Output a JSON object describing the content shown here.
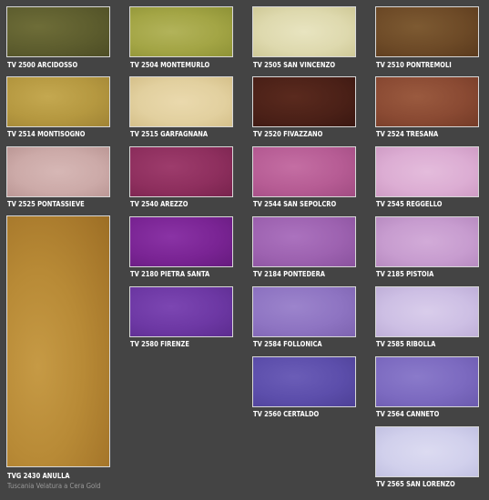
{
  "swatches": [
    {
      "code": "TV 2500 ARCIDOSSO",
      "color": "#5d5d2e"
    },
    {
      "code": "TV 2504 MONTEMURLO",
      "color": "#a3a545"
    },
    {
      "code": "TV 2505 SAN VINCENZO",
      "color": "#ded9ae"
    },
    {
      "code": "TV 2510 PONTREMOLI",
      "color": "#6d4a27"
    },
    {
      "code": "TV 2514 MONTISOGNO",
      "color": "#b59840"
    },
    {
      "code": "TV 2515 GARFAGNANA",
      "color": "#e2d09f"
    },
    {
      "code": "TV 2520 FIVAZZANO",
      "color": "#4a2017"
    },
    {
      "code": "TV 2524 TRESANA",
      "color": "#8a4a33"
    },
    {
      "code": "TV 2525 PONTASSIEVE",
      "color": "#ccaaa8"
    },
    {
      "code": "TV 2540 AREZZO",
      "color": "#8e2f5e"
    },
    {
      "code": "TV 2544 SAN SEPOLCRO",
      "color": "#b65c94"
    },
    {
      "code": "TV 2545 REGGELLO",
      "color": "#dcadd3"
    },
    {
      "code": "TVG 2430 ANULLA",
      "color": "#b88a36"
    },
    {
      "code": "TV 2180 PIETRA SANTA",
      "color": "#7a2494"
    },
    {
      "code": "TV 2184 PONTEDERA",
      "color": "#9d62b0"
    },
    {
      "code": "TV 2185 PISTOIA",
      "color": "#c79ccf"
    },
    {
      "code": "TV 2580 FIRENZE",
      "color": "#6d38a4"
    },
    {
      "code": "TV 2584 FOLLONICA",
      "color": "#8e74c2"
    },
    {
      "code": "TV 2585 RIBOLLA",
      "color": "#cdbfe4"
    },
    {
      "code": "TV 2560 CERTALDO",
      "color": "#5c4eab"
    },
    {
      "code": "TV 2564 CANNETO",
      "color": "#7c6ac0"
    },
    {
      "code": "TV 2565 SAN LORENZO",
      "color": "#d1d0ec"
    }
  ],
  "footnote": "Tuscania Velatura a Cera Gold"
}
